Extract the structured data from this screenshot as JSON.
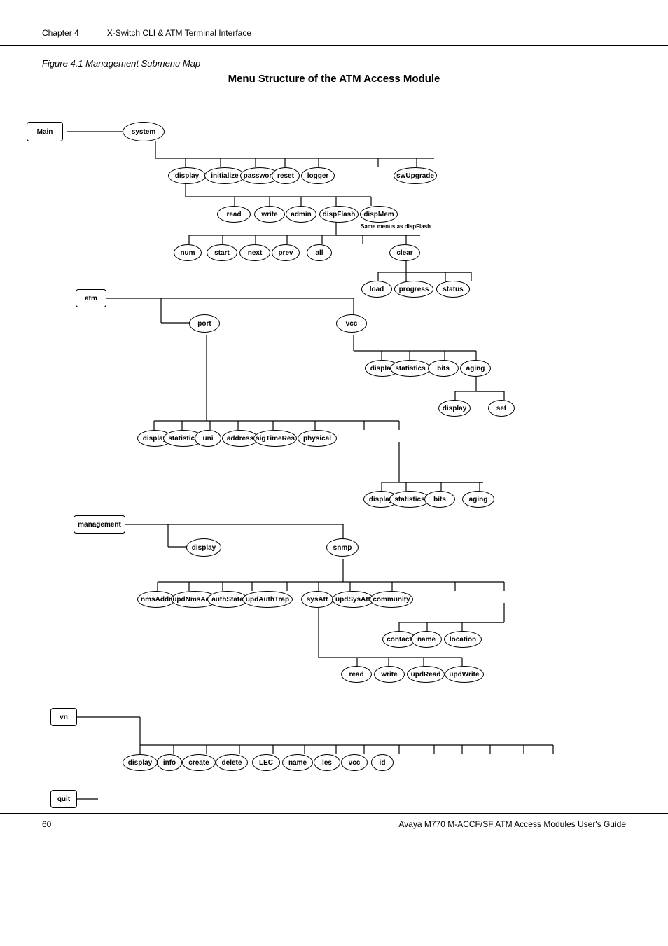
{
  "header": {
    "chapter": "Chapter 4",
    "title": "X-Switch CLI & ATM Terminal Interface"
  },
  "figure": {
    "caption": "Figure 4.1    Management Submenu Map",
    "title": "Menu Structure of the ATM Access Module"
  },
  "footer": {
    "page": "60",
    "doc": "Avaya M770 M-ACCF/SF ATM Access Modules User's Guide"
  },
  "nodes": {
    "main": "Main",
    "system": "system",
    "display1": "display",
    "initialize": "initialize",
    "password": "password",
    "reset": "reset",
    "logger": "logger",
    "swUpgrade": "swUpgrade",
    "read1": "read",
    "write1": "write",
    "admin": "admin",
    "dispFlash": "dispFlash",
    "dispMem": "dispMem",
    "num": "num",
    "start": "start",
    "next": "next",
    "prev": "prev",
    "all": "all",
    "clear": "clear",
    "load": "load",
    "progress": "progress",
    "status": "status",
    "atm": "atm",
    "port": "port",
    "vcc": "vcc",
    "display_vcc": "display",
    "statistics_vcc": "statistics",
    "bits_vcc": "bits",
    "aging_vcc": "aging",
    "display_aging": "display",
    "set_aging": "set",
    "display_port": "display",
    "statistics_port": "statistics",
    "uni": "uni",
    "address": "address",
    "sigTimeRes": "sigTimeRes",
    "physical": "physical",
    "display_phys": "display",
    "statistics_phys": "statistics",
    "bits_phys": "bits",
    "aging_phys": "aging",
    "management": "management",
    "display_mgmt": "display",
    "snmp": "snmp",
    "nmsAddr": "nmsAddr",
    "updNmsAddr": "updNmsAddr",
    "authState": "authState",
    "updAuthTrap": "updAuthTrap",
    "sysAtt": "sysAtt",
    "updSysAtt": "updSysAtt",
    "community": "community",
    "contact": "contact",
    "name_comm": "name",
    "location": "location",
    "read_comm": "read",
    "write_comm": "write",
    "updRead": "updRead",
    "updWrite": "updWrite",
    "vn": "vn",
    "display_vn": "display",
    "info_vn": "info",
    "create_vn": "create",
    "delete_vn": "delete",
    "LEC": "LEC",
    "name_vn": "name",
    "les": "les",
    "vcc_vn": "vcc",
    "id_vn": "id",
    "quit": "quit",
    "same_note": "Same menus\nas dispFlash"
  }
}
